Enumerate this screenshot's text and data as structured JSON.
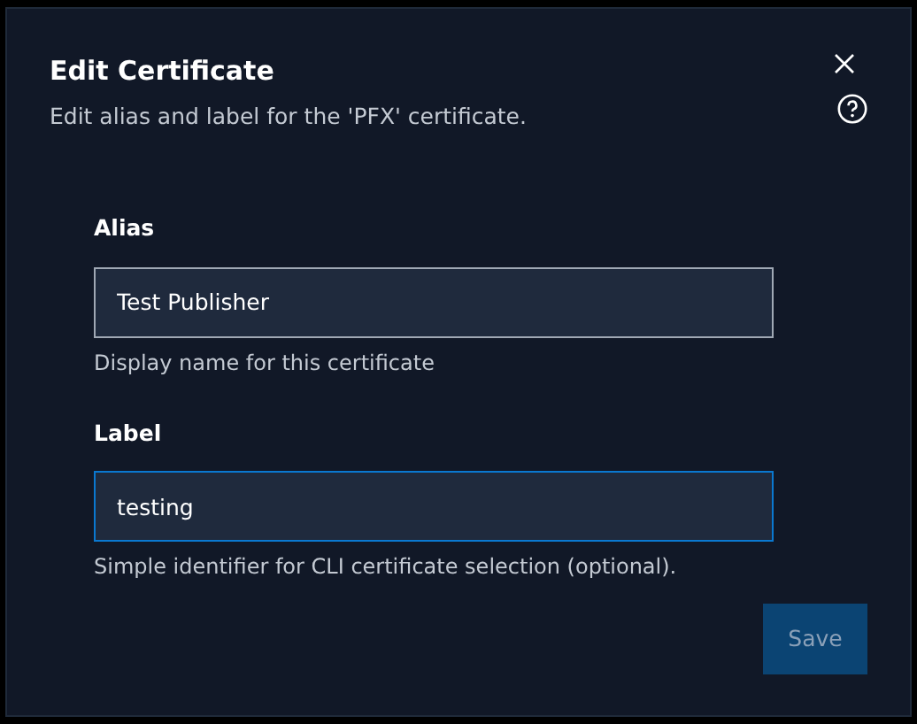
{
  "dialog": {
    "title": "Edit Certificate",
    "subtitle": "Edit alias and label for the 'PFX' certificate."
  },
  "fields": [
    {
      "label": "Alias",
      "value": "Test Publisher",
      "hint": "Display name for this certificate",
      "focused": false
    },
    {
      "label": "Label",
      "value": "testing",
      "hint": "Simple identifier for CLI certificate selection (optional).",
      "focused": true
    }
  ],
  "save_button": {
    "label": "Save",
    "disabled": true
  }
}
